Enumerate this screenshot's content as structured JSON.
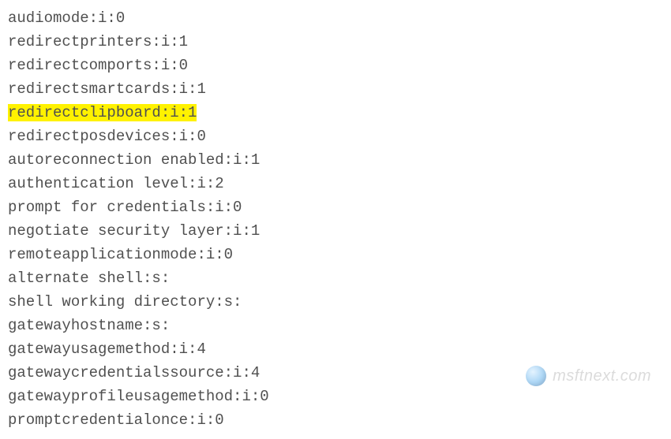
{
  "config": {
    "lines": [
      {
        "text": "audiomode:i:0",
        "highlighted": false
      },
      {
        "text": "redirectprinters:i:1",
        "highlighted": false
      },
      {
        "text": "redirectcomports:i:0",
        "highlighted": false
      },
      {
        "text": "redirectsmartcards:i:1",
        "highlighted": false
      },
      {
        "text": "redirectclipboard:i:1",
        "highlighted": true
      },
      {
        "text": "redirectposdevices:i:0",
        "highlighted": false
      },
      {
        "text": "autoreconnection enabled:i:1",
        "highlighted": false
      },
      {
        "text": "authentication level:i:2",
        "highlighted": false
      },
      {
        "text": "prompt for credentials:i:0",
        "highlighted": false
      },
      {
        "text": "negotiate security layer:i:1",
        "highlighted": false
      },
      {
        "text": "remoteapplicationmode:i:0",
        "highlighted": false
      },
      {
        "text": "alternate shell:s:",
        "highlighted": false
      },
      {
        "text": "shell working directory:s:",
        "highlighted": false
      },
      {
        "text": "gatewayhostname:s:",
        "highlighted": false
      },
      {
        "text": "gatewayusagemethod:i:4",
        "highlighted": false
      },
      {
        "text": "gatewaycredentialssource:i:4",
        "highlighted": false
      },
      {
        "text": "gatewayprofileusagemethod:i:0",
        "highlighted": false
      },
      {
        "text": "promptcredentialonce:i:0",
        "highlighted": false
      }
    ]
  },
  "watermark": {
    "text": "msftnext.com"
  }
}
